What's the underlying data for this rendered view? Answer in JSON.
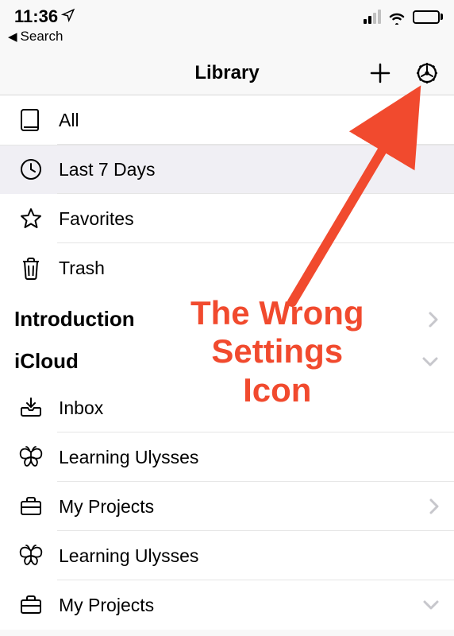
{
  "status": {
    "time": "11:36",
    "back_label": "Search"
  },
  "navbar": {
    "title": "Library"
  },
  "filters": {
    "all": "All",
    "last7": "Last 7 Days",
    "favorites": "Favorites",
    "trash": "Trash"
  },
  "sections": {
    "introduction": {
      "title": "Introduction"
    },
    "icloud": {
      "title": "iCloud",
      "items": [
        {
          "label": "Inbox",
          "icon": "inbox",
          "chevron": ""
        },
        {
          "label": "Learning Ulysses",
          "icon": "butterfly",
          "chevron": ""
        },
        {
          "label": "My Projects",
          "icon": "briefcase",
          "chevron": "right"
        },
        {
          "label": "Learning Ulysses",
          "icon": "butterfly",
          "chevron": ""
        },
        {
          "label": "My Projects",
          "icon": "briefcase",
          "chevron": "down"
        }
      ]
    }
  },
  "annotation": {
    "line1": "The Wrong",
    "line2": "Settings",
    "line3": "Icon",
    "color": "#f14a2e"
  }
}
